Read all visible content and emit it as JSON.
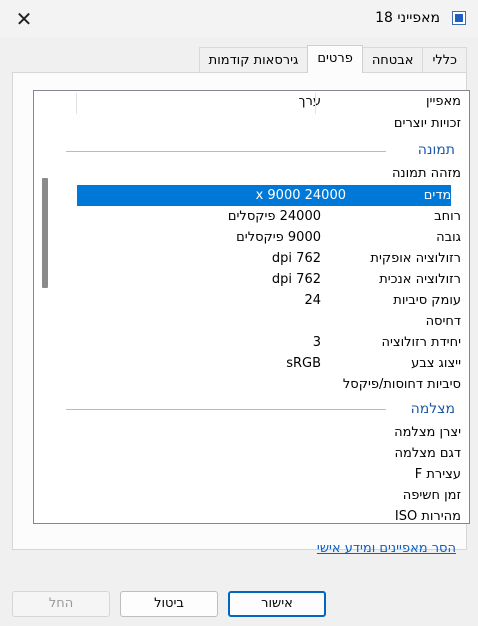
{
  "window": {
    "title": "מאפייני 18"
  },
  "tabs": [
    "כללי",
    "אבטחה",
    "פרטים",
    "גירסאות קודמות"
  ],
  "active_tab": "פרטים",
  "list": {
    "header": {
      "property": "מאפיין",
      "value": "ערך"
    },
    "rows_top": [
      {
        "property": "זכויות יוצרים",
        "value": ""
      }
    ],
    "image_group": {
      "title": "תמונה",
      "rows": [
        {
          "property": "מזהה תמונה",
          "value": ""
        },
        {
          "property": "מימדים",
          "value": "24000 x 9000"
        },
        {
          "property": "רוחב",
          "value": "24000 פיקסלים"
        },
        {
          "property": "גובה",
          "value": "9000 פיקסלים"
        },
        {
          "property": "רזולוציה אופקית",
          "value": "762 dpi"
        },
        {
          "property": "רזולוציה אנכית",
          "value": "762 dpi"
        },
        {
          "property": "עומק סיביות",
          "value": "24"
        },
        {
          "property": "דחיסה",
          "value": ""
        },
        {
          "property": "יחידת רזולוציה",
          "value": "3"
        },
        {
          "property": "ייצוג צבע",
          "value": "sRGB"
        },
        {
          "property": "סיביות דחוסות/פיקסל",
          "value": ""
        }
      ]
    },
    "camera_group": {
      "title": "מצלמה",
      "rows": [
        {
          "property": "יצרן מצלמה",
          "value": ""
        },
        {
          "property": "דגם מצלמה",
          "value": ""
        },
        {
          "property": "עצירת F",
          "value": ""
        },
        {
          "property": "זמן חשיפה",
          "value": ""
        },
        {
          "property": "מהירות ISO",
          "value": ""
        }
      ]
    },
    "selected_property": "מימדים"
  },
  "remove_link": "הסר מאפיינים ומידע אישי",
  "buttons": {
    "ok": "אישור",
    "cancel": "ביטול",
    "apply": "החל"
  },
  "colors": {
    "selection": "#0078d7",
    "group_title": "#1e57a8",
    "link": "#0b5fc6"
  }
}
